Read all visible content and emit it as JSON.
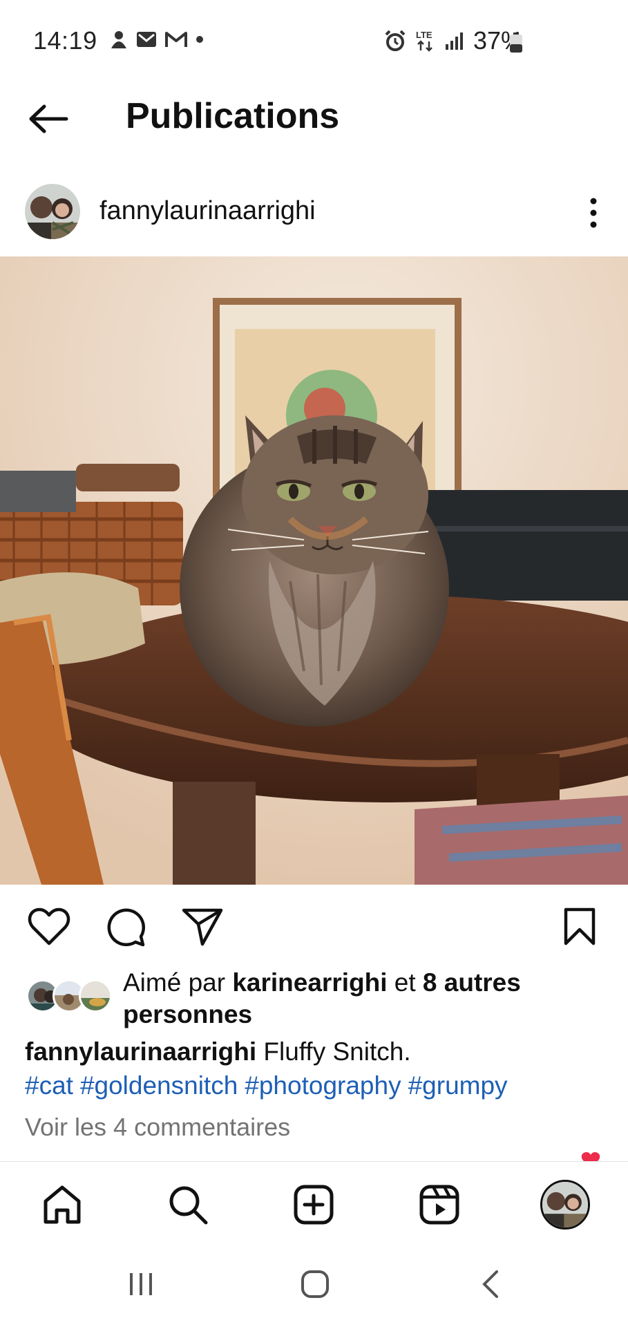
{
  "status_bar": {
    "time": "14:19",
    "network": "LTE",
    "battery": "37%"
  },
  "header": {
    "title": "Publications"
  },
  "post": {
    "username": "fannylaurinaarrighi",
    "likes_prefix": "Aimé par ",
    "likes_user": "karinearrighi",
    "likes_mid": " et ",
    "likes_count": "8 autres personnes",
    "caption_user": "fannylaurinaarrighi",
    "caption_text": " Fluffy Snitch.",
    "hashtags": [
      "#cat",
      "#goldensnitch",
      "#photography",
      "#grumpy"
    ],
    "view_comments": "Voir les 4 commentaires"
  },
  "colors": {
    "hashtag": "#1d5fb5",
    "muted": "#737373"
  },
  "icons": {
    "back": "arrow-left-icon",
    "more": "more-vertical-icon",
    "like": "heart-icon",
    "comment": "comment-icon",
    "share": "send-icon",
    "save": "bookmark-icon",
    "home": "home-icon",
    "search": "search-icon",
    "create": "plus-square-icon",
    "reels": "reels-icon"
  }
}
